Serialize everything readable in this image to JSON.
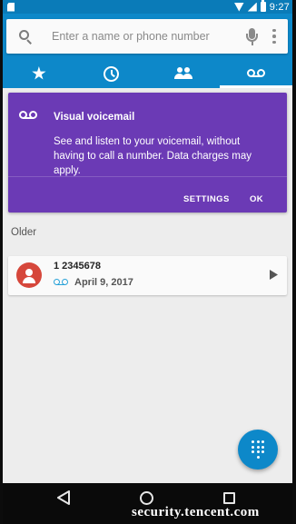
{
  "status_bar": {
    "time": "9:27"
  },
  "search": {
    "placeholder": "Enter a name or phone number"
  },
  "tabs": [
    {
      "icon": "star-icon",
      "label": "Favorites"
    },
    {
      "icon": "clock-icon",
      "label": "Recents"
    },
    {
      "icon": "people-icon",
      "label": "Contacts"
    },
    {
      "icon": "voicemail-icon",
      "label": "Voicemail",
      "active": true
    }
  ],
  "promo": {
    "title": "Visual voicemail",
    "body": "See and listen to your voicemail, without having to call a number. Data charges may apply.",
    "settings_label": "SETTINGS",
    "ok_label": "OK"
  },
  "section": {
    "older_label": "Older"
  },
  "voicemail_entry": {
    "number": "1 2345678",
    "date": "April 9, 2017"
  },
  "watermark": "security.tencent.com",
  "colors": {
    "status_bar": "#0a7bb8",
    "header": "#0d88c9",
    "promo_card": "#6b3ab5",
    "avatar": "#d6473b",
    "voicemail_icon_accent": "#29a2d8",
    "fab": "#0d88c9"
  }
}
